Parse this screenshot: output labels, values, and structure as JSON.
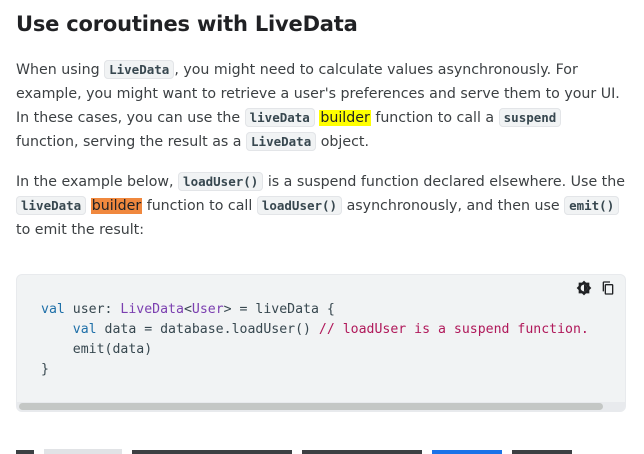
{
  "heading": "Use coroutines with LiveData",
  "para1": {
    "t1": "When using ",
    "c1": "LiveData",
    "t2": ", you might need to calculate values asynchronously. For example, you might want to retrieve a user's preferences and serve them to your UI. In these cases, you can use the ",
    "c2": "liveData",
    "t3": " ",
    "hl": "builder",
    "t4": " function to call a ",
    "c3": "suspend",
    "t5": " function, serving the result as a ",
    "c4": "LiveData",
    "t6": " object."
  },
  "para2": {
    "t1": "In the example below, ",
    "c1": "loadUser()",
    "t2": " is a suspend function declared elsewhere. Use the ",
    "c2": "liveData",
    "t3": " ",
    "hl": "builder",
    "t4": " function to call ",
    "c3": "loadUser()",
    "t5": " asynchronously, and then use ",
    "c4": "emit()",
    "t6": " to emit the result:"
  },
  "code": {
    "l1_kw": "val",
    "l1_a": " user: ",
    "l1_ty1": "LiveData",
    "l1_b": "<",
    "l1_ty2": "User",
    "l1_c": "> = liveData {",
    "l2_indent": "    ",
    "l2_kw": "val",
    "l2_a": " data = database.loadUser() ",
    "l2_cm": "// loadUser is a suspend function.",
    "l3": "    emit(data)",
    "l4": "}"
  },
  "colors": {
    "highlight_yellow": "#ffff00",
    "highlight_orange": "#f0883e",
    "code_bg": "#f1f3f4"
  },
  "icons": {
    "theme_toggle": "brightness-icon",
    "copy": "copy-icon"
  }
}
